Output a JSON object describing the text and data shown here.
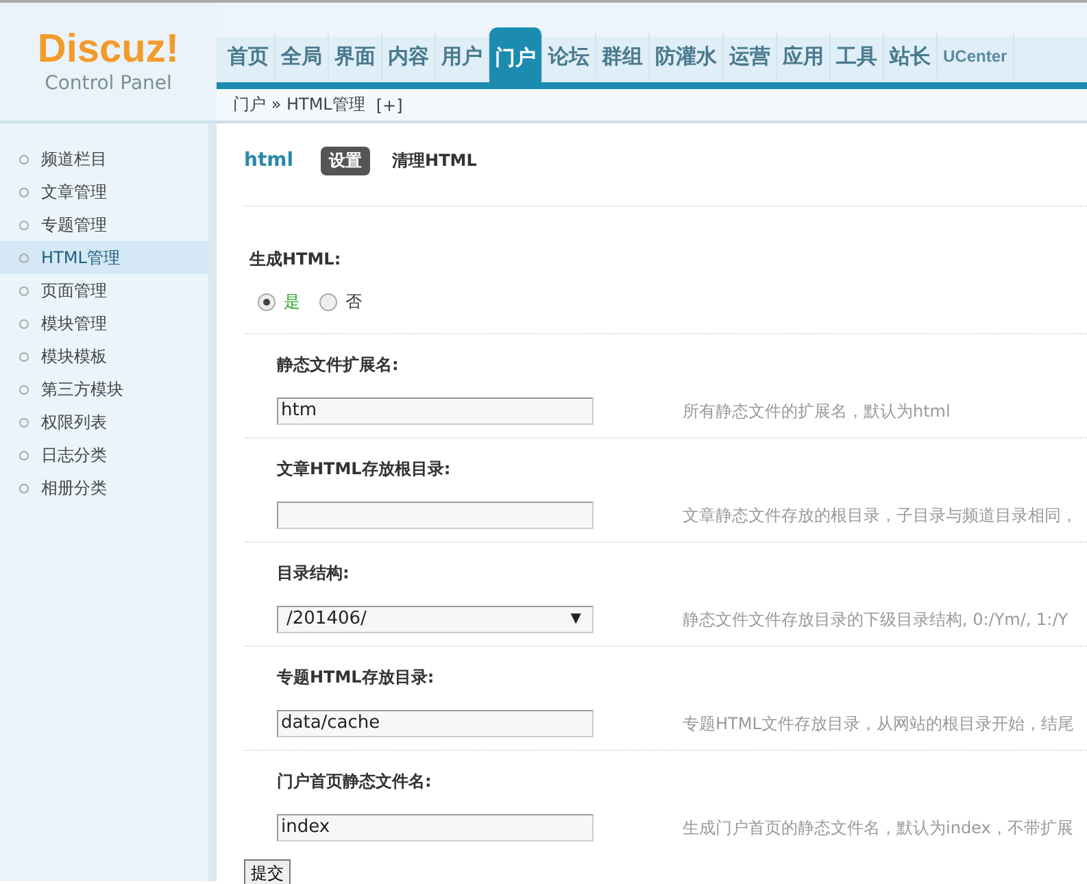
{
  "logo": {
    "name": "Discuz!",
    "subtitle": "Control Panel"
  },
  "nav": [
    {
      "label": "首页",
      "selected": false
    },
    {
      "label": "全局",
      "selected": false
    },
    {
      "label": "界面",
      "selected": false
    },
    {
      "label": "内容",
      "selected": false
    },
    {
      "label": "用户",
      "selected": false
    },
    {
      "label": "门户",
      "selected": true
    },
    {
      "label": "论坛",
      "selected": false
    },
    {
      "label": "群组",
      "selected": false
    },
    {
      "label": "防灌水",
      "selected": false
    },
    {
      "label": "运营",
      "selected": false
    },
    {
      "label": "应用",
      "selected": false
    },
    {
      "label": "工具",
      "selected": false
    },
    {
      "label": "站长",
      "selected": false
    },
    {
      "label": "UCenter",
      "selected": false
    }
  ],
  "breadcrumb": {
    "path": "门户 » HTML管理",
    "add": "[+]"
  },
  "sidebar": {
    "items": [
      {
        "label": "频道栏目",
        "selected": false
      },
      {
        "label": "文章管理",
        "selected": false
      },
      {
        "label": "专题管理",
        "selected": false
      },
      {
        "label": "HTML管理",
        "selected": true
      },
      {
        "label": "页面管理",
        "selected": false
      },
      {
        "label": "模块管理",
        "selected": false
      },
      {
        "label": "模块模板",
        "selected": false
      },
      {
        "label": "第三方模块",
        "selected": false
      },
      {
        "label": "权限列表",
        "selected": false
      },
      {
        "label": "日志分类",
        "selected": false
      },
      {
        "label": "相册分类",
        "selected": false
      }
    ]
  },
  "page": {
    "title": "html",
    "tabs": [
      {
        "label": "设置",
        "selected": true
      },
      {
        "label": "清理HTML",
        "selected": false
      }
    ]
  },
  "generate": {
    "label": "生成HTML:",
    "options": [
      {
        "label": "是",
        "selected": true
      },
      {
        "label": "否",
        "selected": false
      }
    ]
  },
  "fields": [
    {
      "kind": "text",
      "label": "静态文件扩展名:",
      "value": "htm",
      "hint": "所有静态文件的扩展名，默认为html"
    },
    {
      "kind": "text",
      "label": "文章HTML存放根目录:",
      "hint": "文章静态文件存放的根目录，子目录与频道目录相同，"
    },
    {
      "kind": "select",
      "label": "目录结构:",
      "value": "/201406/",
      "arrow": "▼",
      "hint": "静态文件文件存放目录的下级目录结构, 0:/Ym/, 1:/Y"
    },
    {
      "kind": "text",
      "label": "专题HTML存放目录:",
      "value": "data/cache",
      "hint": "专题HTML文件存放目录，从网站的根目录开始，结尾"
    },
    {
      "kind": "text",
      "label": "门户首页静态文件名:",
      "value": "index",
      "hint": "生成门户首页的静态文件名，默认为index，不带扩展"
    }
  ],
  "submit": "提交"
}
